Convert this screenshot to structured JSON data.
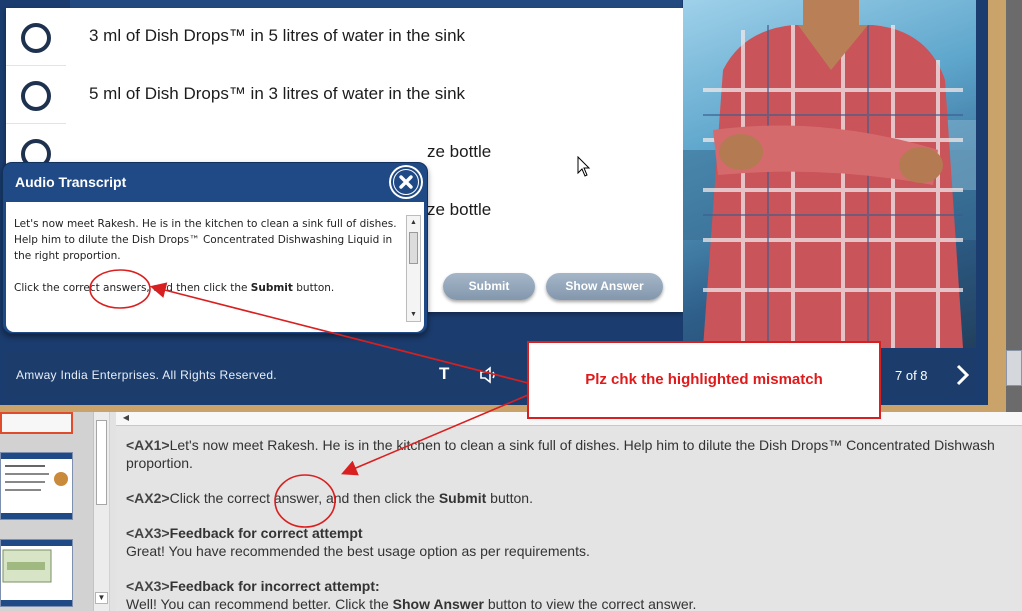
{
  "question": {
    "options": [
      "3 ml of Dish Drops™ in 5 litres of water in the sink",
      "5 ml of Dish Drops™ in 3 litres of water in the sink",
      "ze bottle",
      "ze bottle"
    ],
    "submit_label": "Submit",
    "show_answer_label": "Show Answer"
  },
  "transcript": {
    "title": "Audio Transcript",
    "para1": "Let's now meet Rakesh. He is in the kitchen to clean a sink full of dishes. Help him to dilute the Dish Drops™ Concentrated Dishwashing Liquid in the right proportion.",
    "para2_before": "Click the correct answers, and then click the ",
    "para2_bold": "Submit",
    "para2_after": " button."
  },
  "player": {
    "copyright": "Amway India Enterprises. All Rights Reserved.",
    "text_toggle": "T",
    "page_counter": "7 of 8"
  },
  "callout": {
    "text": "Plz chk the highlighted mismatch"
  },
  "notes": {
    "ax1_tag": "<AX1>",
    "ax1_text": "Let's now meet Rakesh. He is in the kitchen to clean a sink full of dishes. Help him to dilute the Dish Drops™ Concentrated Dishwash",
    "ax1_cont": "proportion.",
    "ax2_tag": "<AX2>",
    "ax2_before": "Click the correct answer, and then click the ",
    "ax2_bold": "Submit",
    "ax2_after": " button.",
    "ax3a_tag": "<AX3>",
    "ax3a_heading": "Feedback for correct attempt",
    "ax3a_text": "Great! You have recommended the best usage option as per requirements.",
    "ax3b_tag": "<AX3>",
    "ax3b_heading": "Feedback for incorrect attempt:",
    "ax3b_before": "Well! You can recommend better. Click the ",
    "ax3b_bold": "Show Answer",
    "ax3b_after": " button to view the correct answer."
  },
  "colors": {
    "callout_red": "#d92020",
    "player_blue": "#1c3d6c",
    "button_grey_blue": "#8397ad"
  }
}
